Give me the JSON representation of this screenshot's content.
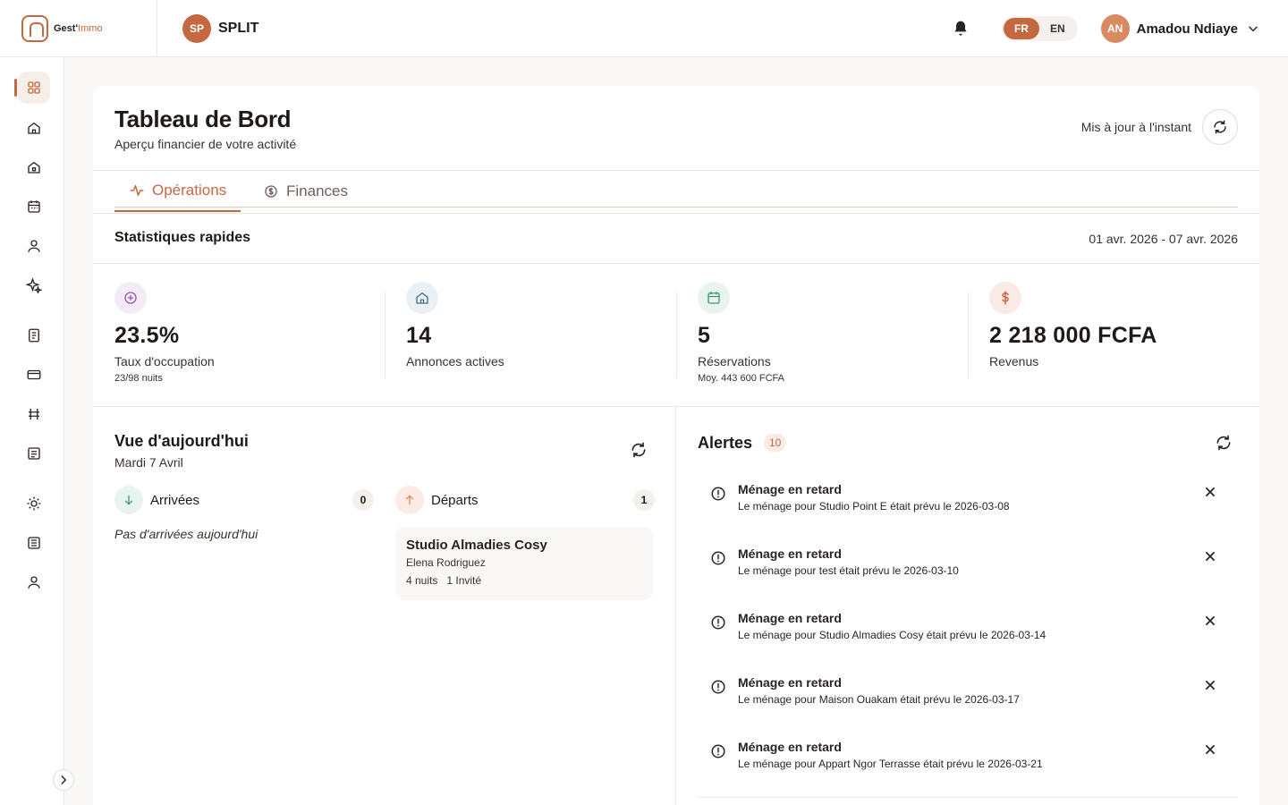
{
  "brand": {
    "name_a": "Gest'",
    "name_b": "Immo"
  },
  "workspace": {
    "initials": "SP",
    "name": "SPLIT"
  },
  "languages": [
    {
      "code": "FR",
      "active": true
    },
    {
      "code": "EN",
      "active": false
    }
  ],
  "user": {
    "initials": "AN",
    "name": "Amadou Ndiaye"
  },
  "sidebar": {
    "icons": [
      "grid-icon",
      "home-icon",
      "building-icon",
      "calendar-icon",
      "user-icon",
      "sparkles-icon",
      "document-icon",
      "card-icon",
      "hash-icon",
      "list-icon",
      "sun-icon",
      "notes-icon",
      "profile-icon"
    ]
  },
  "page": {
    "title": "Tableau de Bord",
    "subtitle": "Aperçu financier de votre activité",
    "updated": "Mis à jour à l'instant"
  },
  "tabs": [
    {
      "label": "Opérations",
      "active": true
    },
    {
      "label": "Finances",
      "active": false
    }
  ],
  "quick": {
    "title": "Statistiques rapides",
    "range": "01 avr. 2026 - 07 avr. 2026"
  },
  "stats": [
    {
      "value": "23.5%",
      "label": "Taux d'occupation",
      "detail": "23/98 nuits"
    },
    {
      "value": "14",
      "label": "Annonces actives",
      "detail": ""
    },
    {
      "value": "5",
      "label": "Réservations",
      "detail": "Moy. 443 600 FCFA"
    },
    {
      "value": "2 218 000 FCFA",
      "label": "Revenus",
      "detail": ""
    }
  ],
  "today": {
    "title": "Vue d'aujourd'hui",
    "date": "Mardi 7 Avril",
    "arrivals": {
      "label": "Arrivées",
      "count": "0",
      "empty": "Pas d'arrivées aujourd'hui"
    },
    "departures": {
      "label": "Départs",
      "count": "1",
      "items": [
        {
          "property": "Studio Almadies Cosy",
          "guest": "Elena Rodriguez",
          "nights": "4 nuits",
          "guests": "1 Invité"
        }
      ]
    }
  },
  "alerts": {
    "title": "Alertes",
    "count": "10",
    "items": [
      {
        "title": "Ménage en retard",
        "desc": "Le ménage pour Studio Point E était prévu le 2026-03-08"
      },
      {
        "title": "Ménage en retard",
        "desc": "Le ménage pour test était prévu le 2026-03-10"
      },
      {
        "title": "Ménage en retard",
        "desc": "Le ménage pour Studio Almadies Cosy était prévu le 2026-03-14"
      },
      {
        "title": "Ménage en retard",
        "desc": "Le ménage pour Maison Ouakam était prévu le 2026-03-17"
      },
      {
        "title": "Ménage en retard",
        "desc": "Le ménage pour Appart Ngor Terrasse était prévu le 2026-03-21"
      }
    ]
  },
  "colors": {
    "accent": "#c4683f",
    "purple": "#8e5bb5",
    "blue": "#4a6f8a",
    "green": "#3d9a6c",
    "red": "#c4683f"
  }
}
